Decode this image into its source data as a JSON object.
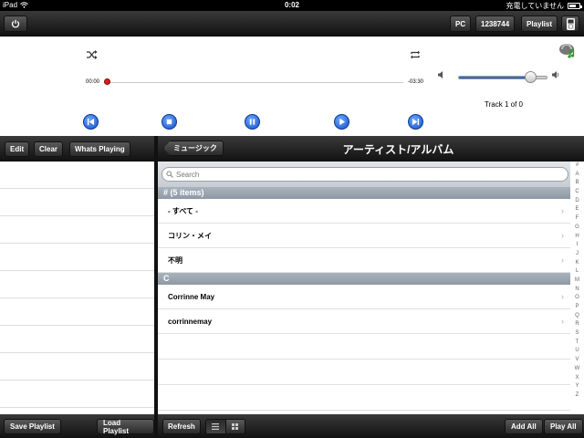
{
  "status_bar": {
    "device": "iPad",
    "time": "0:02",
    "charge_status": "充電していません"
  },
  "top_toolbar": {
    "pc_label": "PC",
    "id_label": "1238744",
    "playlist_label": "Playlist"
  },
  "player": {
    "time_elapsed": "00:00",
    "time_remaining": "-03:30",
    "track_info": "Track 1 of 0",
    "playback_progress_fraction": 0.0,
    "volume_fraction": 0.78
  },
  "left_pane": {
    "edit_label": "Edit",
    "clear_label": "Clear",
    "whats_playing_label": "Whats Playing",
    "save_playlist_label": "Save Playlist",
    "load_playlist_label": "Load Playlist"
  },
  "library": {
    "back_label": "ミュージック",
    "title": "アーティスト/アルバム",
    "search_placeholder": "Search",
    "sections": [
      {
        "header": "# (5 items)",
        "rows": [
          "- すべて -",
          "コリン・メイ",
          "不明"
        ]
      },
      {
        "header": "C",
        "rows": [
          "Corrinne May",
          "corrinnemay"
        ]
      }
    ],
    "index": [
      "#",
      "A",
      "B",
      "C",
      "D",
      "E",
      "F",
      "G",
      "H",
      "I",
      "J",
      "K",
      "L",
      "M",
      "N",
      "O",
      "P",
      "Q",
      "R",
      "S",
      "T",
      "U",
      "V",
      "W",
      "X",
      "Y",
      "Z"
    ],
    "refresh_label": "Refresh",
    "add_all_label": "Add All",
    "play_all_label": "Play All"
  },
  "icons": {
    "shuffle": "shuffle-icon",
    "repeat": "repeat-icon",
    "prev": "skip-back-icon",
    "stop": "stop-icon",
    "pause": "pause-icon",
    "play": "play-icon",
    "next": "skip-forward-icon"
  },
  "colors": {
    "transport_blue": "#1652c8",
    "progress_knob": "#d62020",
    "section_header": "#9aa4ae"
  }
}
